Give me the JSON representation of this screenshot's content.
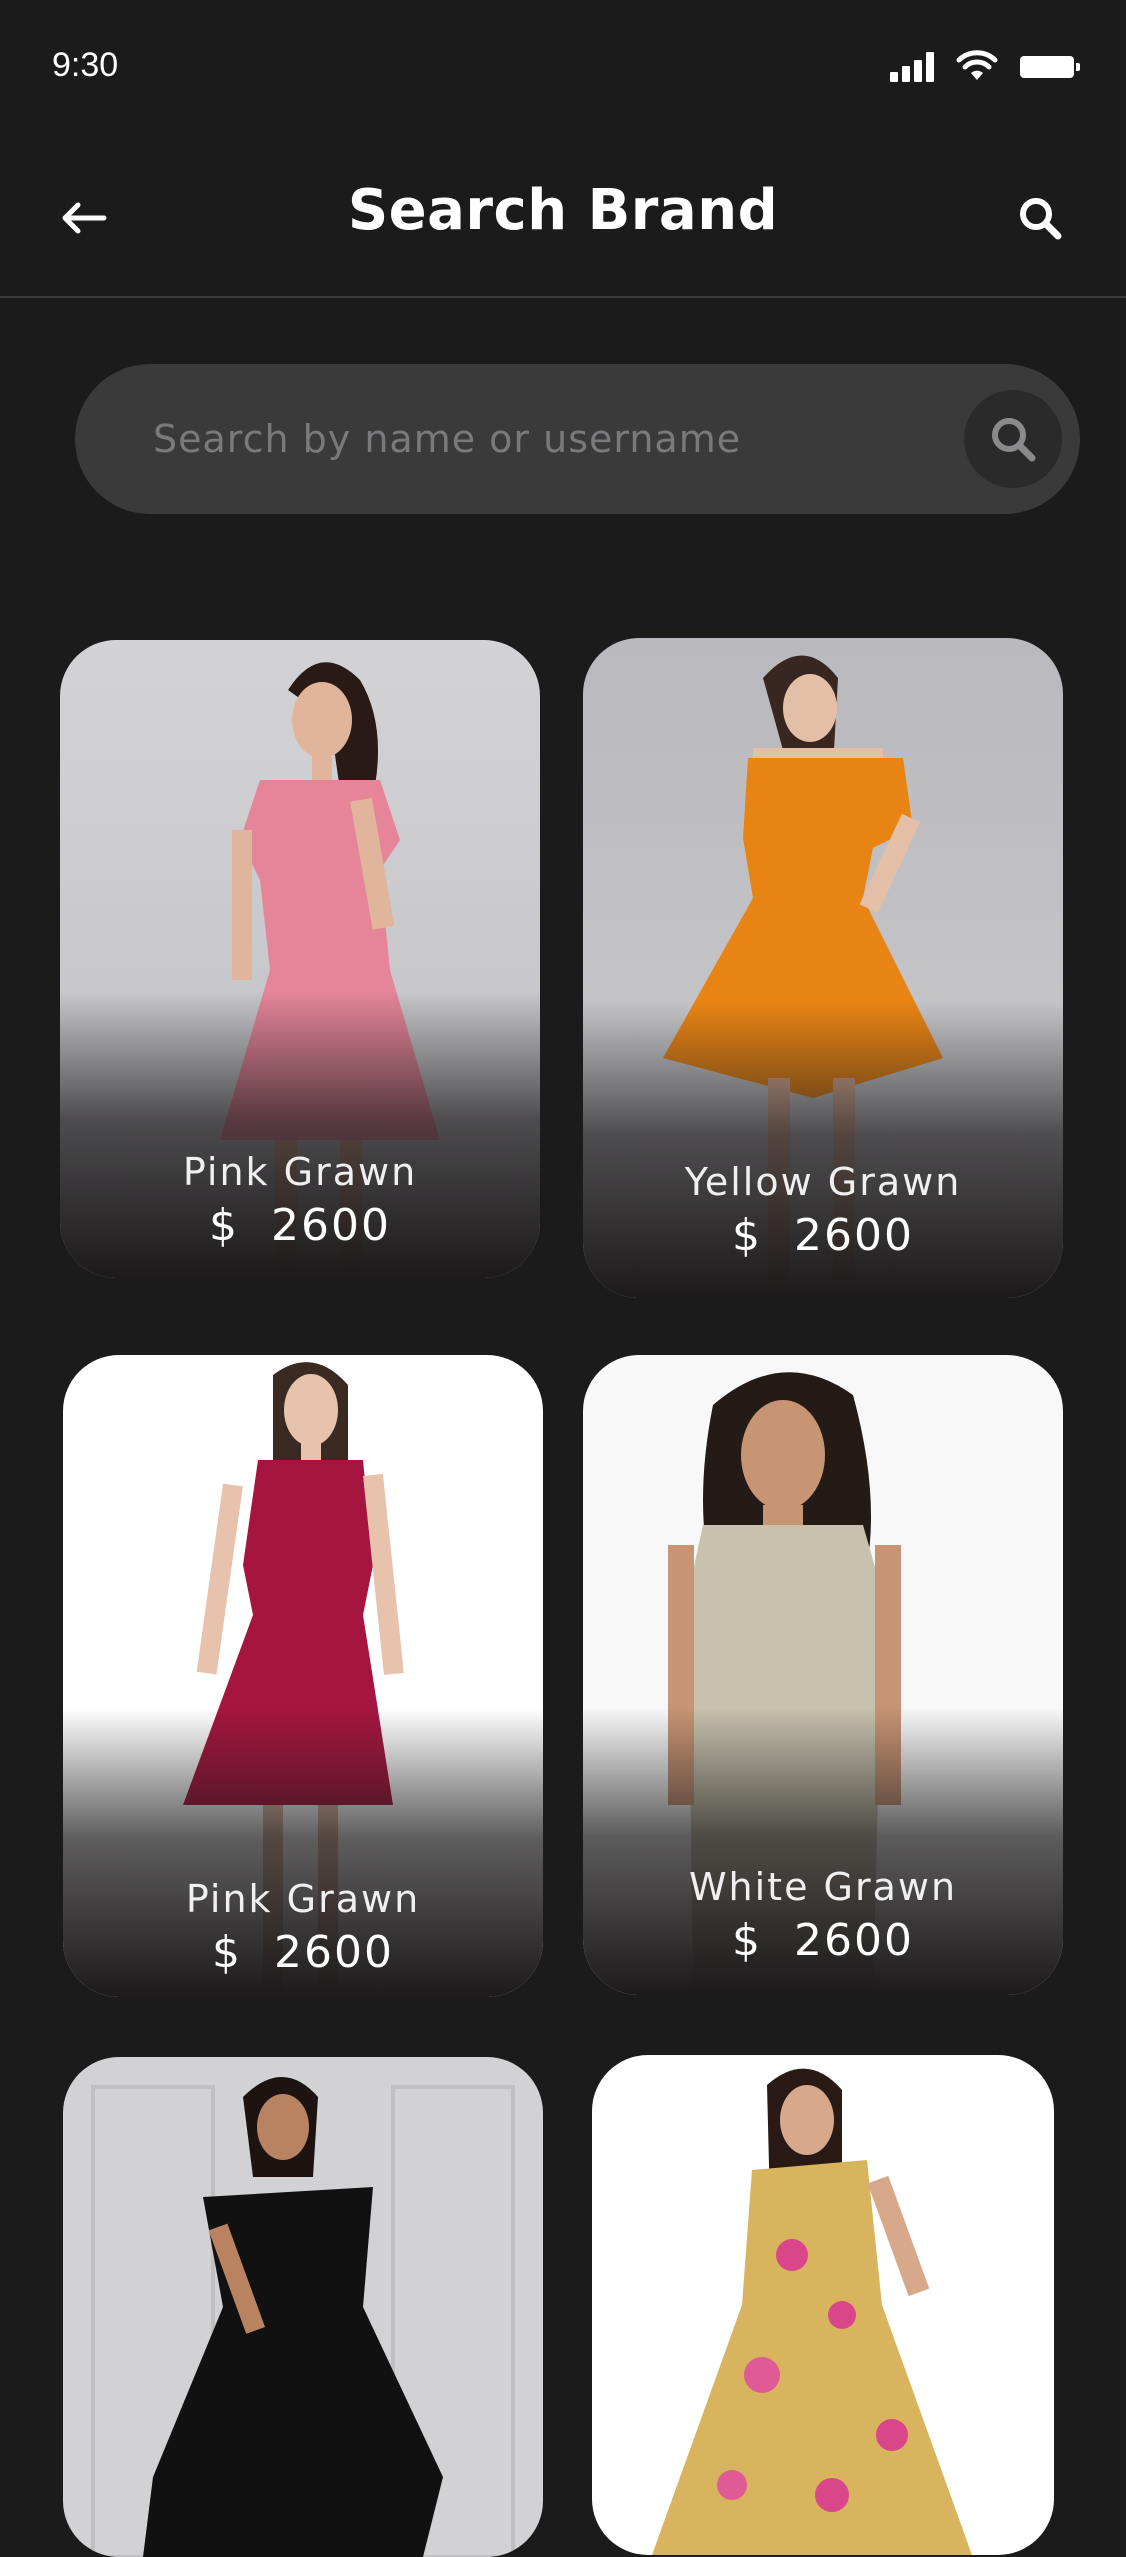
{
  "status": {
    "time": "9:30"
  },
  "header": {
    "title": "Search Brand"
  },
  "search": {
    "placeholder": "Search by name or username"
  },
  "currency_symbol": "$",
  "products": [
    {
      "name": "Pink Grawn",
      "price": "2600",
      "dress_color": "#e6859a"
    },
    {
      "name": "Yellow Grawn",
      "price": "2600",
      "dress_color": "#e88414"
    },
    {
      "name": "Pink Grawn",
      "price": "2600",
      "dress_color": "#a5153f"
    },
    {
      "name": "White Grawn",
      "price": "2600",
      "dress_color": "#c7c2ad"
    },
    {
      "name": "",
      "price": "",
      "dress_color": "#111111"
    },
    {
      "name": "",
      "price": "",
      "dress_color": "#d8b45e"
    }
  ],
  "colors": {
    "background": "#1b1b1c",
    "search_bg": "#3a3a3b",
    "text": "#ffffff"
  }
}
